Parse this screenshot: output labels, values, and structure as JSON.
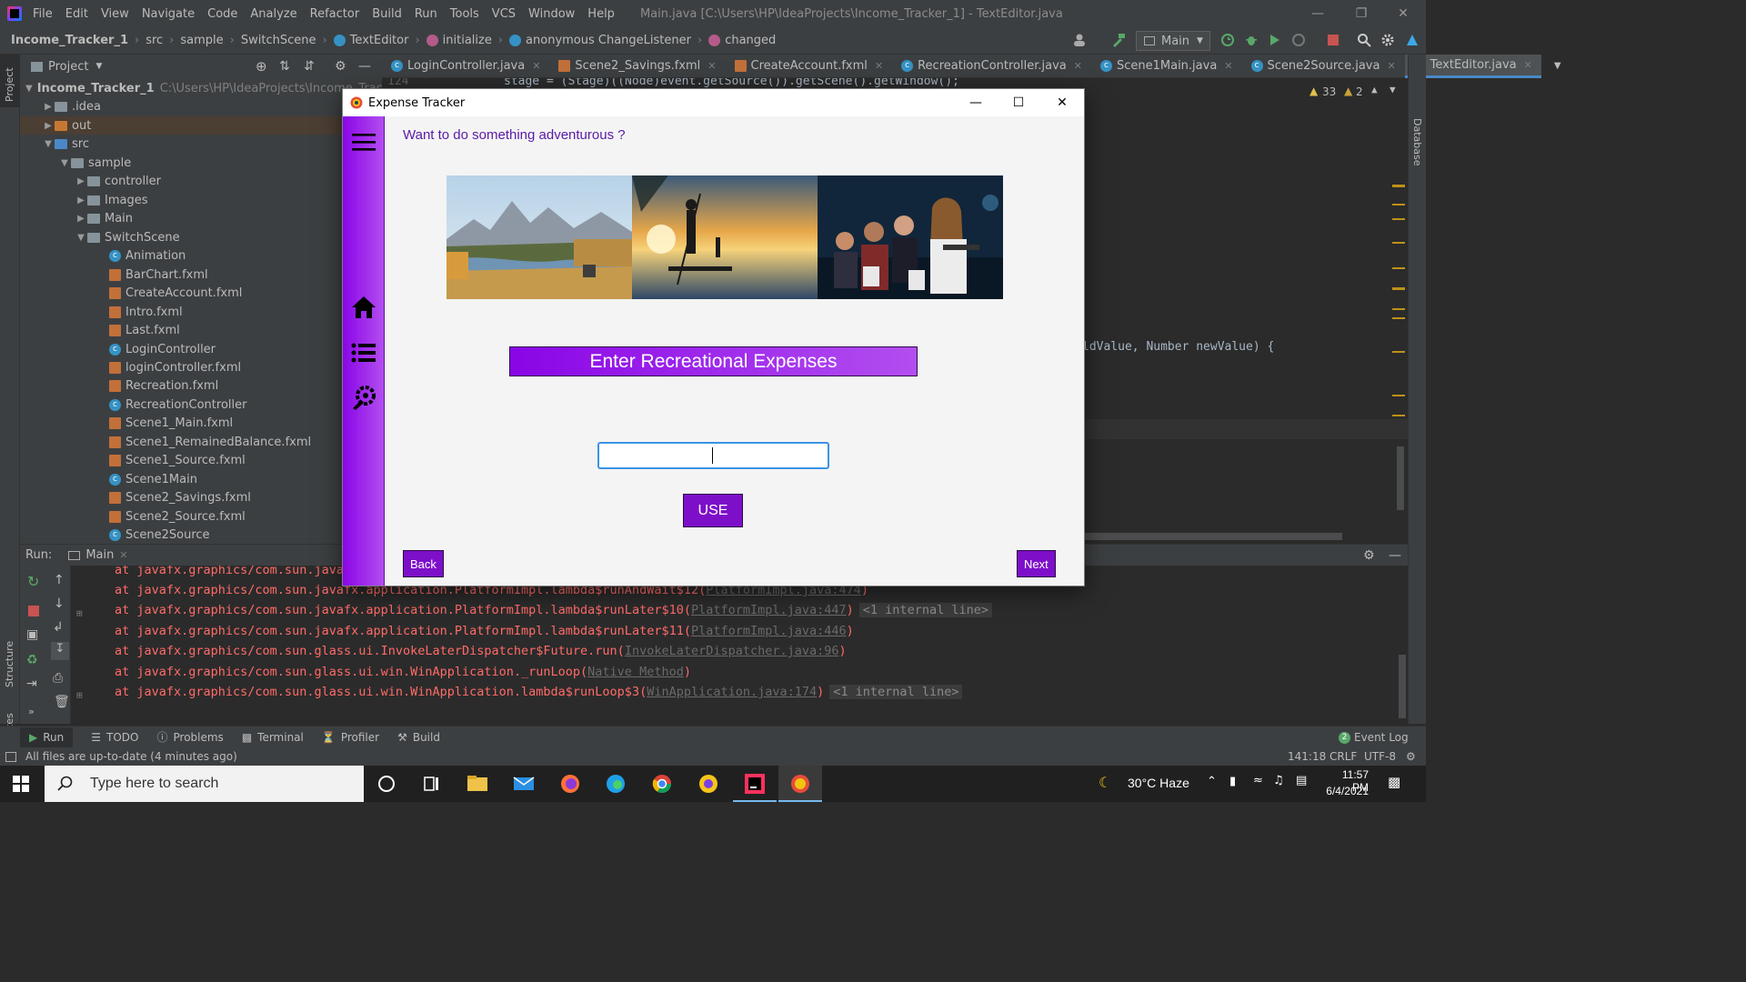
{
  "menubar": {
    "items": [
      "File",
      "Edit",
      "View",
      "Navigate",
      "Code",
      "Analyze",
      "Refactor",
      "Build",
      "Run",
      "Tools",
      "VCS",
      "Window",
      "Help"
    ],
    "window_title": "Main.java [C:\\Users\\HP\\IdeaProjects\\Income_Tracker_1] - TextEditor.java"
  },
  "breadcrumb": {
    "items": [
      "Income_Tracker_1",
      "src",
      "sample",
      "SwitchScene",
      "TextEditor",
      "initialize",
      "anonymous ChangeListener",
      "changed"
    ],
    "run_config": "Main"
  },
  "project_panel": {
    "title": "Project",
    "root_name": "Income_Tracker_1",
    "root_path": "C:\\Users\\HP\\IdeaProjects\\Income_Tracker_1",
    "tree": [
      {
        "label": ".idea",
        "type": "folder"
      },
      {
        "label": "out",
        "type": "folder-orange"
      },
      {
        "label": "src",
        "type": "folder-blue"
      },
      {
        "label": "sample",
        "type": "folder"
      },
      {
        "label": "controller",
        "type": "folder"
      },
      {
        "label": "Images",
        "type": "folder"
      },
      {
        "label": "Main",
        "type": "folder"
      },
      {
        "label": "SwitchScene",
        "type": "folder"
      },
      {
        "label": "Animation",
        "type": "class"
      },
      {
        "label": "BarChart.fxml",
        "type": "fxml"
      },
      {
        "label": "CreateAccount.fxml",
        "type": "fxml"
      },
      {
        "label": "Intro.fxml",
        "type": "fxml"
      },
      {
        "label": "Last.fxml",
        "type": "fxml"
      },
      {
        "label": "LoginController",
        "type": "class"
      },
      {
        "label": "loginController.fxml",
        "type": "fxml"
      },
      {
        "label": "Recreation.fxml",
        "type": "fxml"
      },
      {
        "label": "RecreationController",
        "type": "class"
      },
      {
        "label": "Scene1_Main.fxml",
        "type": "fxml"
      },
      {
        "label": "Scene1_RemainedBalance.fxml",
        "type": "fxml"
      },
      {
        "label": "Scene1_Source.fxml",
        "type": "fxml"
      },
      {
        "label": "Scene1Main",
        "type": "class"
      },
      {
        "label": "Scene2_Savings.fxml",
        "type": "fxml"
      },
      {
        "label": "Scene2_Source.fxml",
        "type": "fxml"
      },
      {
        "label": "Scene2Source",
        "type": "class"
      }
    ]
  },
  "editor": {
    "tabs": [
      "LoginController.java",
      "Scene2_Savings.fxml",
      "CreateAccount.fxml",
      "RecreationController.java",
      "Scene1Main.java",
      "Scene2Source.java",
      "TextEditor.java"
    ],
    "active_tab": "TextEditor.java",
    "line_number": "124",
    "code_line_top": "stage = (Stage)((Node)event.getSource()).getScene().getWindow();",
    "code_line_mid": "ldValue, Number newValue) {",
    "warnings": "33",
    "weak_warnings": "2"
  },
  "run_panel": {
    "label": "Run:",
    "config": "Main",
    "lines": [
      {
        "text": "at javafx.graphics/com.sun.java",
        "link": "",
        "fold": ""
      },
      {
        "text": "at javafx.graphics/com.sun.javafx.application.PlatformImpl.lambda$runAndWait$12(",
        "link": "PlatformImpl.java:474",
        "tail": ")",
        "fold": ""
      },
      {
        "text": "at javafx.graphics/com.sun.javafx.application.PlatformImpl.lambda$runLater$10(",
        "link": "PlatformImpl.java:447",
        "tail": ")",
        "fold": "<1 internal line>"
      },
      {
        "text": "at javafx.graphics/com.sun.javafx.application.PlatformImpl.lambda$runLater$11(",
        "link": "PlatformImpl.java:446",
        "tail": ")",
        "fold": ""
      },
      {
        "text": "at javafx.graphics/com.sun.glass.ui.InvokeLaterDispatcher$Future.run(",
        "link": "InvokeLaterDispatcher.java:96",
        "tail": ")",
        "fold": ""
      },
      {
        "text": "at javafx.graphics/com.sun.glass.ui.win.WinApplication._runLoop(",
        "link": "Native Method",
        "tail": ")",
        "fold": ""
      },
      {
        "text": "at javafx.graphics/com.sun.glass.ui.win.WinApplication.lambda$runLoop$3(",
        "link": "WinApplication.java:174",
        "tail": ")",
        "fold": "<1 internal line>"
      }
    ]
  },
  "bottom_tabs": {
    "run": "Run",
    "todo": "TODO",
    "problems": "Problems",
    "terminal": "Terminal",
    "profiler": "Profiler",
    "build": "Build",
    "event_log": "Event Log",
    "event_count": "2"
  },
  "statusbar": {
    "message": "All files are up-to-date (4 minutes ago)",
    "position": "141:18",
    "line_ending": "CRLF",
    "encoding": "UTF-8"
  },
  "taskbar": {
    "search_placeholder": "Type here to search",
    "weather": "30°C  Haze",
    "time": "11:57 PM",
    "date": "6/4/2021"
  },
  "expense_tracker": {
    "title": "Expense Tracker",
    "question": "Want to do something adventurous ?",
    "heading": "Enter Recreational Expenses",
    "amount_value": "",
    "use_label": "USE",
    "back_label": "Back",
    "next_label": "Next"
  },
  "colors": {
    "accent_purple": "#8a05e6",
    "button_purple": "#7d0fc9",
    "ide_bg": "#2b2b2b",
    "ide_panel": "#3c3f41",
    "error_text": "#ff6b68"
  }
}
